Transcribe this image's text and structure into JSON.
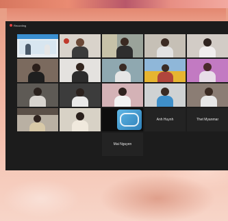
{
  "window": {
    "recording_label": "Recording"
  },
  "participants": {
    "p17_name": "Anh Huynh",
    "p18_name": "Thet Myanmar",
    "p19_name": "Mai Nguyen"
  },
  "colors": {
    "window_bg": "#1c1c1c",
    "name_tile_bg": "#232323",
    "recording_dot": "#e04040"
  }
}
